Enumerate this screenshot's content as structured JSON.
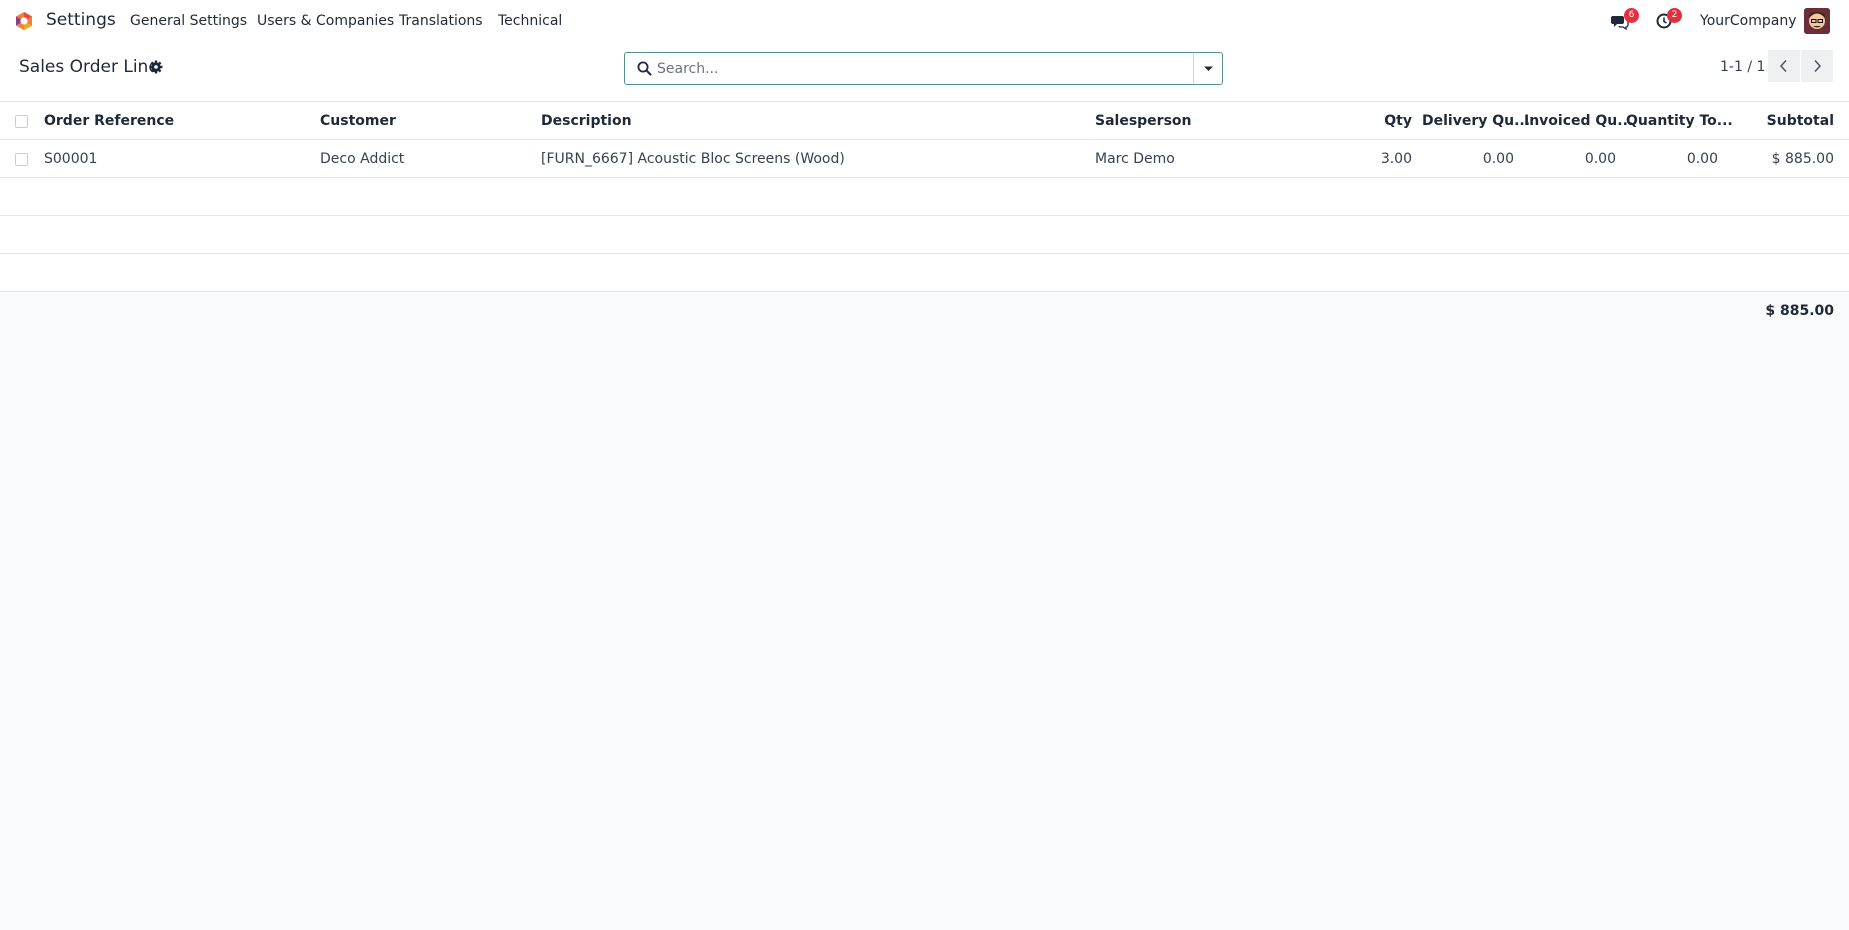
{
  "navbar": {
    "app_name": "Settings",
    "menus": [
      "General Settings",
      "Users & Companies",
      "Translations",
      "Technical"
    ],
    "messages_badge": "6",
    "activities_badge": "2",
    "company": "YourCompany"
  },
  "control_panel": {
    "breadcrumb": "Sales Order Line",
    "search_placeholder": "Search...",
    "pager": "1-1 / 1"
  },
  "table": {
    "columns": [
      "Order Reference",
      "Customer",
      "Description",
      "Salesperson",
      "Qty",
      "Delivery Qu...",
      "Invoiced Qu...",
      "Quantity To...",
      "Subtotal"
    ],
    "rows": [
      {
        "order_reference": "S00001",
        "customer": "Deco Addict",
        "description": "[FURN_6667] Acoustic Bloc Screens (Wood)",
        "salesperson": "Marc Demo",
        "qty": "3.00",
        "delivery_qty": "0.00",
        "invoiced_qty": "0.00",
        "qty_to_invoice": "0.00",
        "subtotal": "$ 885.00"
      }
    ],
    "total": "$ 885.00"
  },
  "colors": {
    "accent": "#5a8e9a",
    "badge": "#e2303f",
    "background": "#f9fafb"
  }
}
